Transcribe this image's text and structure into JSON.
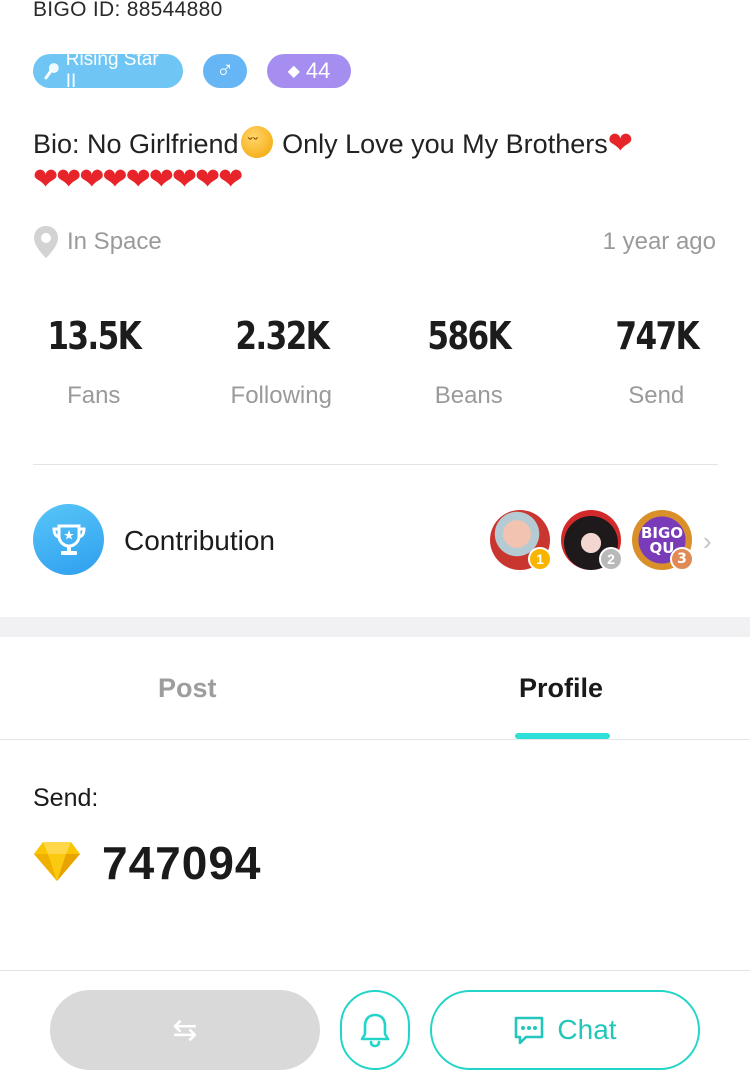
{
  "profile": {
    "bigo_id": "BIGO ID: 88544880",
    "badges": {
      "rank_label": "Rising Star II",
      "gender_symbol": "♂",
      "level": "44"
    },
    "bio_text_1": "Bio:  No Girlfriend",
    "bio_text_2": " Only Love you My Brothers",
    "location": "In Space",
    "time_ago": "1 year ago"
  },
  "stats": [
    {
      "value": "13.5K",
      "label": "Fans"
    },
    {
      "value": "2.32K",
      "label": "Following"
    },
    {
      "value": "586K",
      "label": "Beans"
    },
    {
      "value": "747K",
      "label": "Send"
    }
  ],
  "contribution": {
    "label": "Contribution",
    "avatar_3_text": "BIGO QU",
    "ranks": [
      "1",
      "2",
      "3"
    ]
  },
  "tabs": {
    "post": "Post",
    "profile": "Profile"
  },
  "send_section": {
    "label": "Send:",
    "value": "747094"
  },
  "bottom_bar": {
    "switch_symbol": "⇆",
    "chat_label": "Chat"
  },
  "colors": {
    "accent": "#23d4c8",
    "rank_badge": "#6fc6f4",
    "level_badge": "#a58ef0",
    "heart": "#e8242b"
  }
}
